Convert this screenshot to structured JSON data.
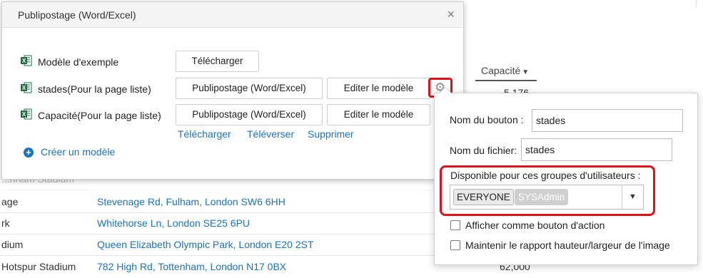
{
  "background_table": {
    "capacity_header": "Capacité",
    "capacity_first_value": "5 176",
    "rows": [
      {
        "name": "...nham Stadium",
        "address": "...",
        "capacity": ""
      },
      {
        "name": "age",
        "address": "Stevenage Rd, Fulham, London SW6 6HH",
        "capacity": ""
      },
      {
        "name": "rk",
        "address": "Whitehorse Ln, London SE25 6PU",
        "capacity": ""
      },
      {
        "name": "dium",
        "address": "Queen Elizabeth Olympic Park, London E20 2ST",
        "capacity": ""
      },
      {
        "name": "Hotspur Stadium",
        "address": "782 High Rd, Tottenham, London N17 0BX",
        "capacity": "62,000"
      }
    ]
  },
  "modal": {
    "title": "Publipostage (Word/Excel)",
    "close_icon": "×",
    "templates": [
      {
        "label": "Modèle d'exemple",
        "buttons": [
          "Télécharger"
        ]
      },
      {
        "label": "stades(Pour la page liste)",
        "buttons": [
          "Publipostage (Word/Excel)",
          "Editer le modèle"
        ]
      },
      {
        "label": "Capacité(Pour la page liste)",
        "buttons": [
          "Publipostage (Word/Excel)",
          "Editer le modèle"
        ]
      }
    ],
    "links": [
      "Télécharger",
      "Téléverser",
      "Supprimer"
    ],
    "create_label": "Créer un modèle"
  },
  "popover": {
    "button_name_label": "Nom du bouton :",
    "button_name_value": "stades",
    "file_name_label": "Nom du fichier:",
    "file_name_value": "stades",
    "groups_label": "Disponible pour ces groupes d'utilisateurs :",
    "groups": [
      "EVERYONE",
      "SYSAdmin"
    ],
    "checkbox_action": "Afficher comme bouton d'action",
    "checkbox_ratio": "Maintenir le rapport hauteur/largeur de l'image"
  },
  "colors": {
    "link": "#1a73c2",
    "highlight": "#e0101e",
    "excel_green": "#1e7145"
  }
}
